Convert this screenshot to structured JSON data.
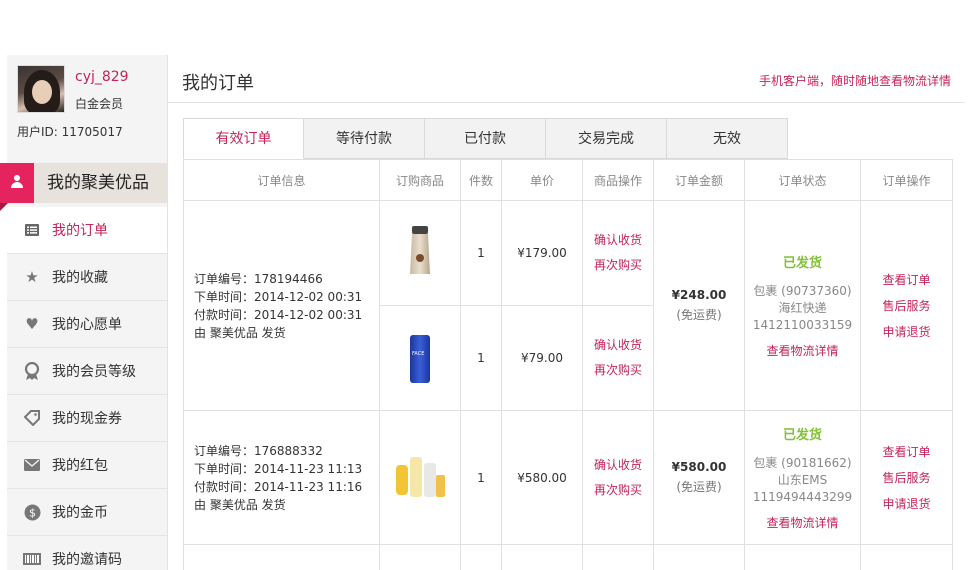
{
  "user": {
    "username": "cyj_829",
    "member_level": "白金会员",
    "user_id_label": "用户ID: 11705017"
  },
  "brand": {
    "title": "我的聚美优品"
  },
  "sidebar": {
    "items": [
      {
        "label": "我的订单",
        "icon": "list-icon",
        "active": true
      },
      {
        "label": "我的收藏",
        "icon": "star-icon"
      },
      {
        "label": "我的心愿单",
        "icon": "heart-icon"
      },
      {
        "label": "我的会员等级",
        "icon": "badge-icon"
      },
      {
        "label": "我的现金券",
        "icon": "coupon-tag-icon"
      },
      {
        "label": "我的红包",
        "icon": "envelope-icon"
      },
      {
        "label": "我的金币",
        "icon": "dollar-coin-icon"
      },
      {
        "label": "我的邀请码",
        "icon": "barcode-icon"
      }
    ]
  },
  "main": {
    "title": "我的订单",
    "mobile_link": "手机客户端，随时随地查看物流详情",
    "tabs": [
      "有效订单",
      "等待付款",
      "已付款",
      "交易完成",
      "无效"
    ],
    "active_tab": 0,
    "columns": [
      "订单信息",
      "订购商品",
      "件数",
      "单价",
      "商品操作",
      "订单金额",
      "订单状态",
      "订单操作"
    ],
    "orders": [
      {
        "order_no": "订单编号：178194466",
        "order_time": "下单时间：2014-12-02 00:31",
        "pay_time": "付款时间：2014-12-02 00:31",
        "shipper": "由 聚美优品 发货",
        "items": [
          {
            "thumb": "hand-cream-tube",
            "qty": "1",
            "price": "¥179.00",
            "op_confirm": "确认收货",
            "op_rebuy": "再次购买"
          },
          {
            "thumb": "blue-face-bottle",
            "qty": "1",
            "price": "¥79.00",
            "op_confirm": "确认收货",
            "op_rebuy": "再次购买"
          }
        ],
        "amount": "¥248.00",
        "shipping": "(免运费)",
        "status": "已发货",
        "package": "包裹 (90737360)",
        "carrier": "海红快递",
        "tracking": "1412110033159",
        "track_link": "查看物流详情",
        "ops": [
          "查看订单",
          "售后服务",
          "申请退货"
        ]
      },
      {
        "order_no": "订单编号：176888332",
        "order_time": "下单时间：2014-11-23 11:13",
        "pay_time": "付款时间：2014-11-23 11:16",
        "shipper": "由 聚美优品 发货",
        "items": [
          {
            "thumb": "skincare-set",
            "qty": "1",
            "price": "¥580.00",
            "op_confirm": "确认收货",
            "op_rebuy": "再次购买"
          }
        ],
        "amount": "¥580.00",
        "shipping": "(免运费)",
        "status": "已发货",
        "package": "包裹 (90181662)",
        "carrier": "山东EMS",
        "tracking": "1119494443299",
        "track_link": "查看物流详情",
        "ops": [
          "查看订单",
          "售后服务",
          "申请退货"
        ]
      }
    ]
  },
  "colors": {
    "accent": "#c3245a",
    "brand_pink": "#e5245f",
    "status_green": "#85c03a"
  }
}
